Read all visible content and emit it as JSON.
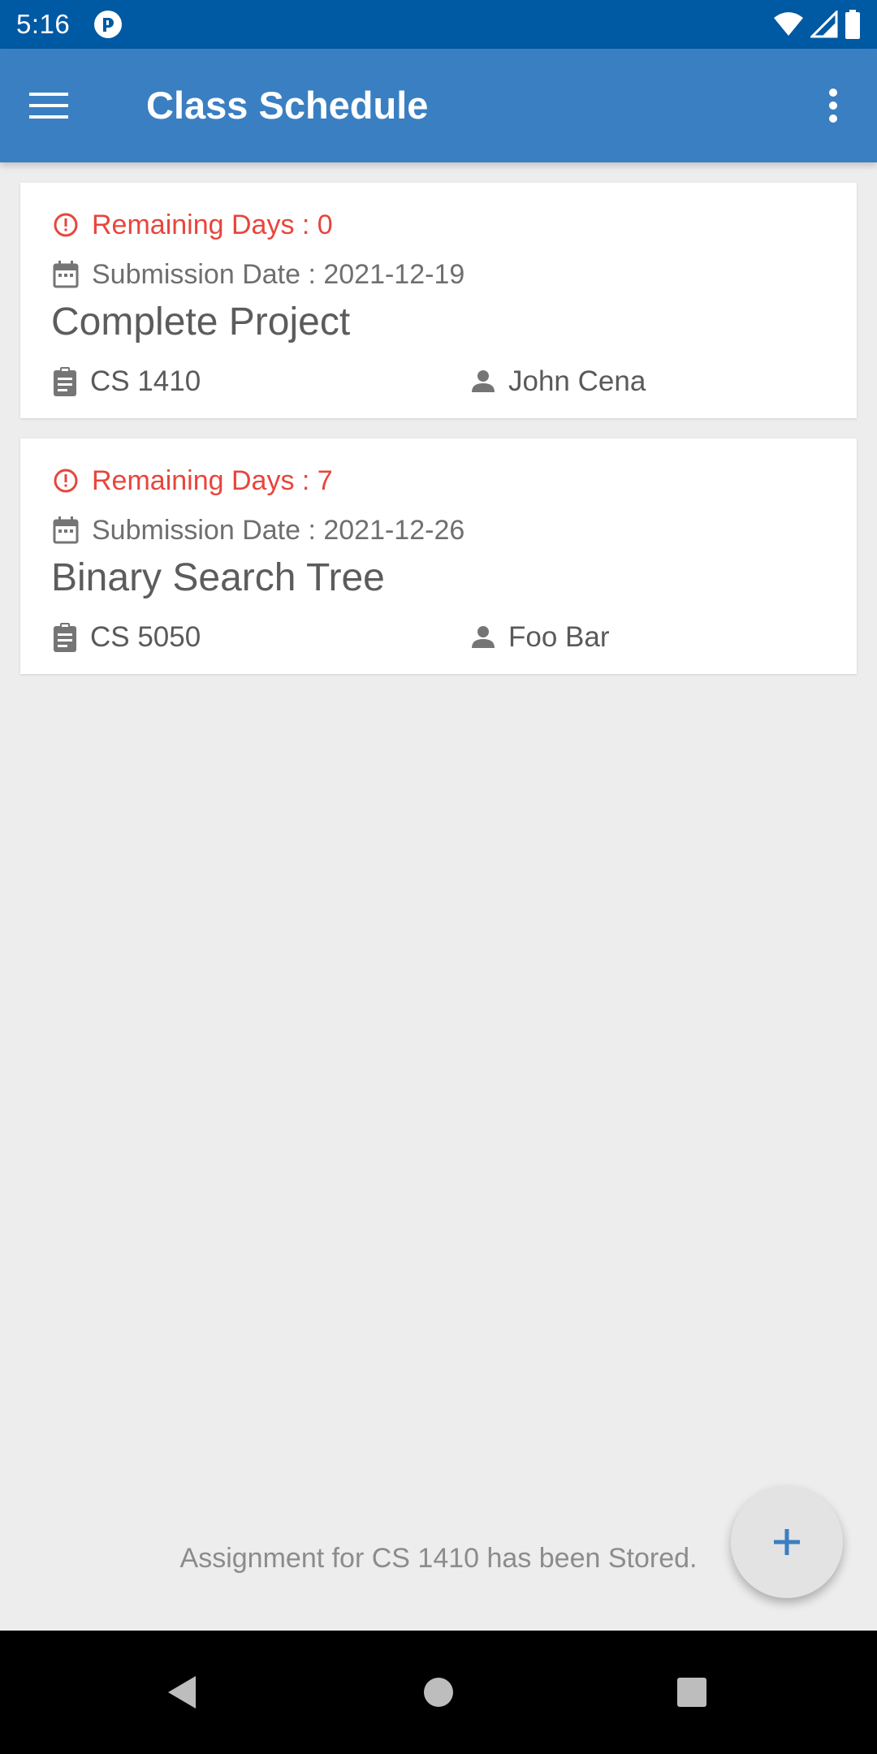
{
  "status_bar": {
    "time": "5:16",
    "icons": [
      "app-notification-icon",
      "wifi-icon",
      "signal-icon",
      "battery-icon"
    ]
  },
  "app_bar": {
    "title": "Class Schedule",
    "menu_icon": "hamburger-menu-icon",
    "overflow_icon": "more-vert-icon"
  },
  "assignments": [
    {
      "remaining": "Remaining Days : 0",
      "submission": "Submission Date : 2021-12-19",
      "title": "Complete Project",
      "course": "CS 1410",
      "teacher": "John Cena"
    },
    {
      "remaining": "Remaining Days : 7",
      "submission": "Submission Date : 2021-12-26",
      "title": "Binary Search Tree",
      "course": "CS 5050",
      "teacher": "Foo Bar"
    }
  ],
  "snackbar": {
    "message": "Assignment for CS 1410 has been Stored."
  },
  "fab": {
    "icon": "plus-icon"
  },
  "colors": {
    "status_bar": "#0059a3",
    "app_bar": "#3a7fc1",
    "background": "#ededed",
    "warning": "#e8453c",
    "fab_icon": "#3a7fc1"
  },
  "nav_bar": {
    "icons": [
      "back-icon",
      "home-icon",
      "recents-icon"
    ]
  }
}
